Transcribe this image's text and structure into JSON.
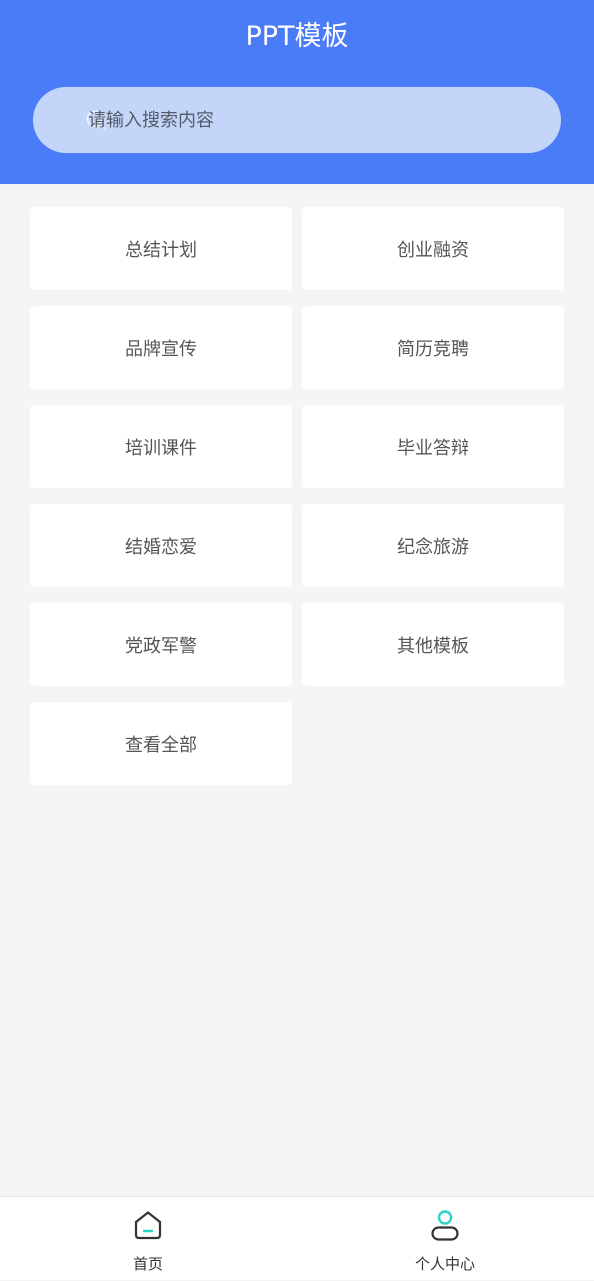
{
  "header": {
    "title": "PPT模板"
  },
  "search": {
    "placeholder": "请输入搜索内容",
    "icon": "search-icon"
  },
  "categories": [
    {
      "label": "总结计划"
    },
    {
      "label": "创业融资"
    },
    {
      "label": "品牌宣传"
    },
    {
      "label": "简历竞聘"
    },
    {
      "label": "培训课件"
    },
    {
      "label": "毕业答辩"
    },
    {
      "label": "结婚恋爱"
    },
    {
      "label": "纪念旅游"
    },
    {
      "label": "党政军警"
    },
    {
      "label": "其他模板"
    },
    {
      "label": "查看全部"
    }
  ],
  "tabbar": {
    "items": [
      {
        "label": "首页",
        "icon": "home-icon"
      },
      {
        "label": "个人中心",
        "icon": "user-icon"
      }
    ]
  },
  "colors": {
    "header_bg": "#4a7cf7",
    "search_bg": "#c3d5f9",
    "page_bg": "#f5f5f5",
    "accent_teal": "#2ed3c4"
  }
}
